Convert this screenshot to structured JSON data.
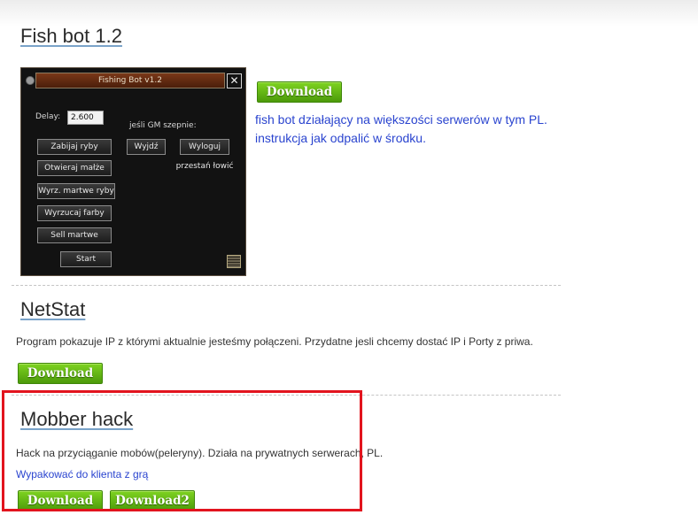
{
  "sections": {
    "fishbot": {
      "title": "Fish bot 1.2",
      "download_label": "Download",
      "description": "fish bot działający na większości serwerów w tym PL. instrukcja jak odpalić w środku.",
      "screenshot": {
        "window_title": "Fishing Bot v1.2",
        "close_label": "✕",
        "delay_label": "Delay:",
        "delay_value": "2.600",
        "gm_label": "jeśli GM szepnie:",
        "buttons": {
          "kill_fish": "Zabijaj ryby",
          "open_clams": "Otwieraj małże",
          "throw_dead_fish": "Wyrz. martwe ryby",
          "throw_paints": "Wyrzucaj farby",
          "sell_dead": "Sell martwe",
          "start": "Start",
          "exit": "Wyjdź",
          "logout": "Wyloguj",
          "stop_fishing": "przestań łowić"
        }
      }
    },
    "netstat": {
      "title": "NetStat",
      "description": "Program pokazuje IP z którymi aktualnie jesteśmy połączeni. Przydatne jesli chcemy dostać IP i Porty z priwa.",
      "download_label": "Download"
    },
    "mobber": {
      "title": "Mobber hack",
      "description": "Hack na przyciąganie mobów(peleryny). Działa na prywatnych serwerach, PL.",
      "link": "Wypakować do klienta z grą",
      "download_label": "Download",
      "download2_label": "Download2"
    }
  },
  "colors": {
    "download_button": "#5fb012",
    "link_blue": "#2a44cf",
    "highlight_box": "#e2141e"
  }
}
